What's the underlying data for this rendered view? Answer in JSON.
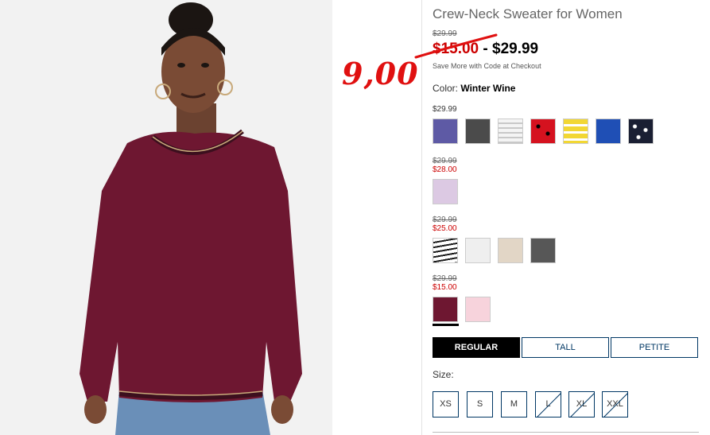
{
  "product": {
    "title": "Crew-Neck Sweater for Women",
    "original_price": "$29.99",
    "sale_price": "$15.00",
    "price_separator": " - ",
    "max_price": "$29.99",
    "save_note": "Save More with Code at Checkout",
    "handwritten_price": "9,00"
  },
  "color": {
    "label": "Color:",
    "selected": "Winter Wine"
  },
  "groups": [
    {
      "price": "$29.99",
      "swatches": [
        {
          "name": "purple",
          "color": "#5e5aa5"
        },
        {
          "name": "charcoal",
          "color": "#4b4b4b"
        },
        {
          "name": "grey-stripe",
          "color": "#d8d8d8"
        },
        {
          "name": "red-dots",
          "color": "#d5121f"
        },
        {
          "name": "yellow-stripe",
          "color": "#f2d733"
        },
        {
          "name": "blue",
          "color": "#1f4fb5"
        },
        {
          "name": "navy-dots",
          "color": "#1a1f33"
        }
      ]
    },
    {
      "original": "$29.99",
      "sale": "$28.00",
      "swatches": [
        {
          "name": "lilac",
          "color": "#dcc9e3"
        }
      ]
    },
    {
      "original": "$29.99",
      "sale": "$25.00",
      "swatches": [
        {
          "name": "black-white-stripe",
          "color": "#ffffff"
        },
        {
          "name": "white",
          "color": "#efefef"
        },
        {
          "name": "oatmeal",
          "color": "#e2d6c6"
        },
        {
          "name": "grey-heather",
          "color": "#575757"
        }
      ]
    },
    {
      "original": "$29.99",
      "sale": "$15.00",
      "swatches": [
        {
          "name": "winter-wine",
          "color": "#6e1731"
        },
        {
          "name": "light-pink",
          "color": "#f7d3dc"
        }
      ]
    }
  ],
  "fit": {
    "options": [
      "REGULAR",
      "TALL",
      "PETITE"
    ],
    "selected": "REGULAR"
  },
  "size": {
    "label": "Size:",
    "options": [
      {
        "label": "XS",
        "available": true
      },
      {
        "label": "S",
        "available": true
      },
      {
        "label": "M",
        "available": true
      },
      {
        "label": "L",
        "available": false
      },
      {
        "label": "XL",
        "available": false
      },
      {
        "label": "XXL",
        "available": false
      }
    ]
  },
  "colors": {
    "sale_red": "#cc0000",
    "annotation_red": "#e01010",
    "border_navy": "#003764",
    "sweater": "#6e1731"
  }
}
